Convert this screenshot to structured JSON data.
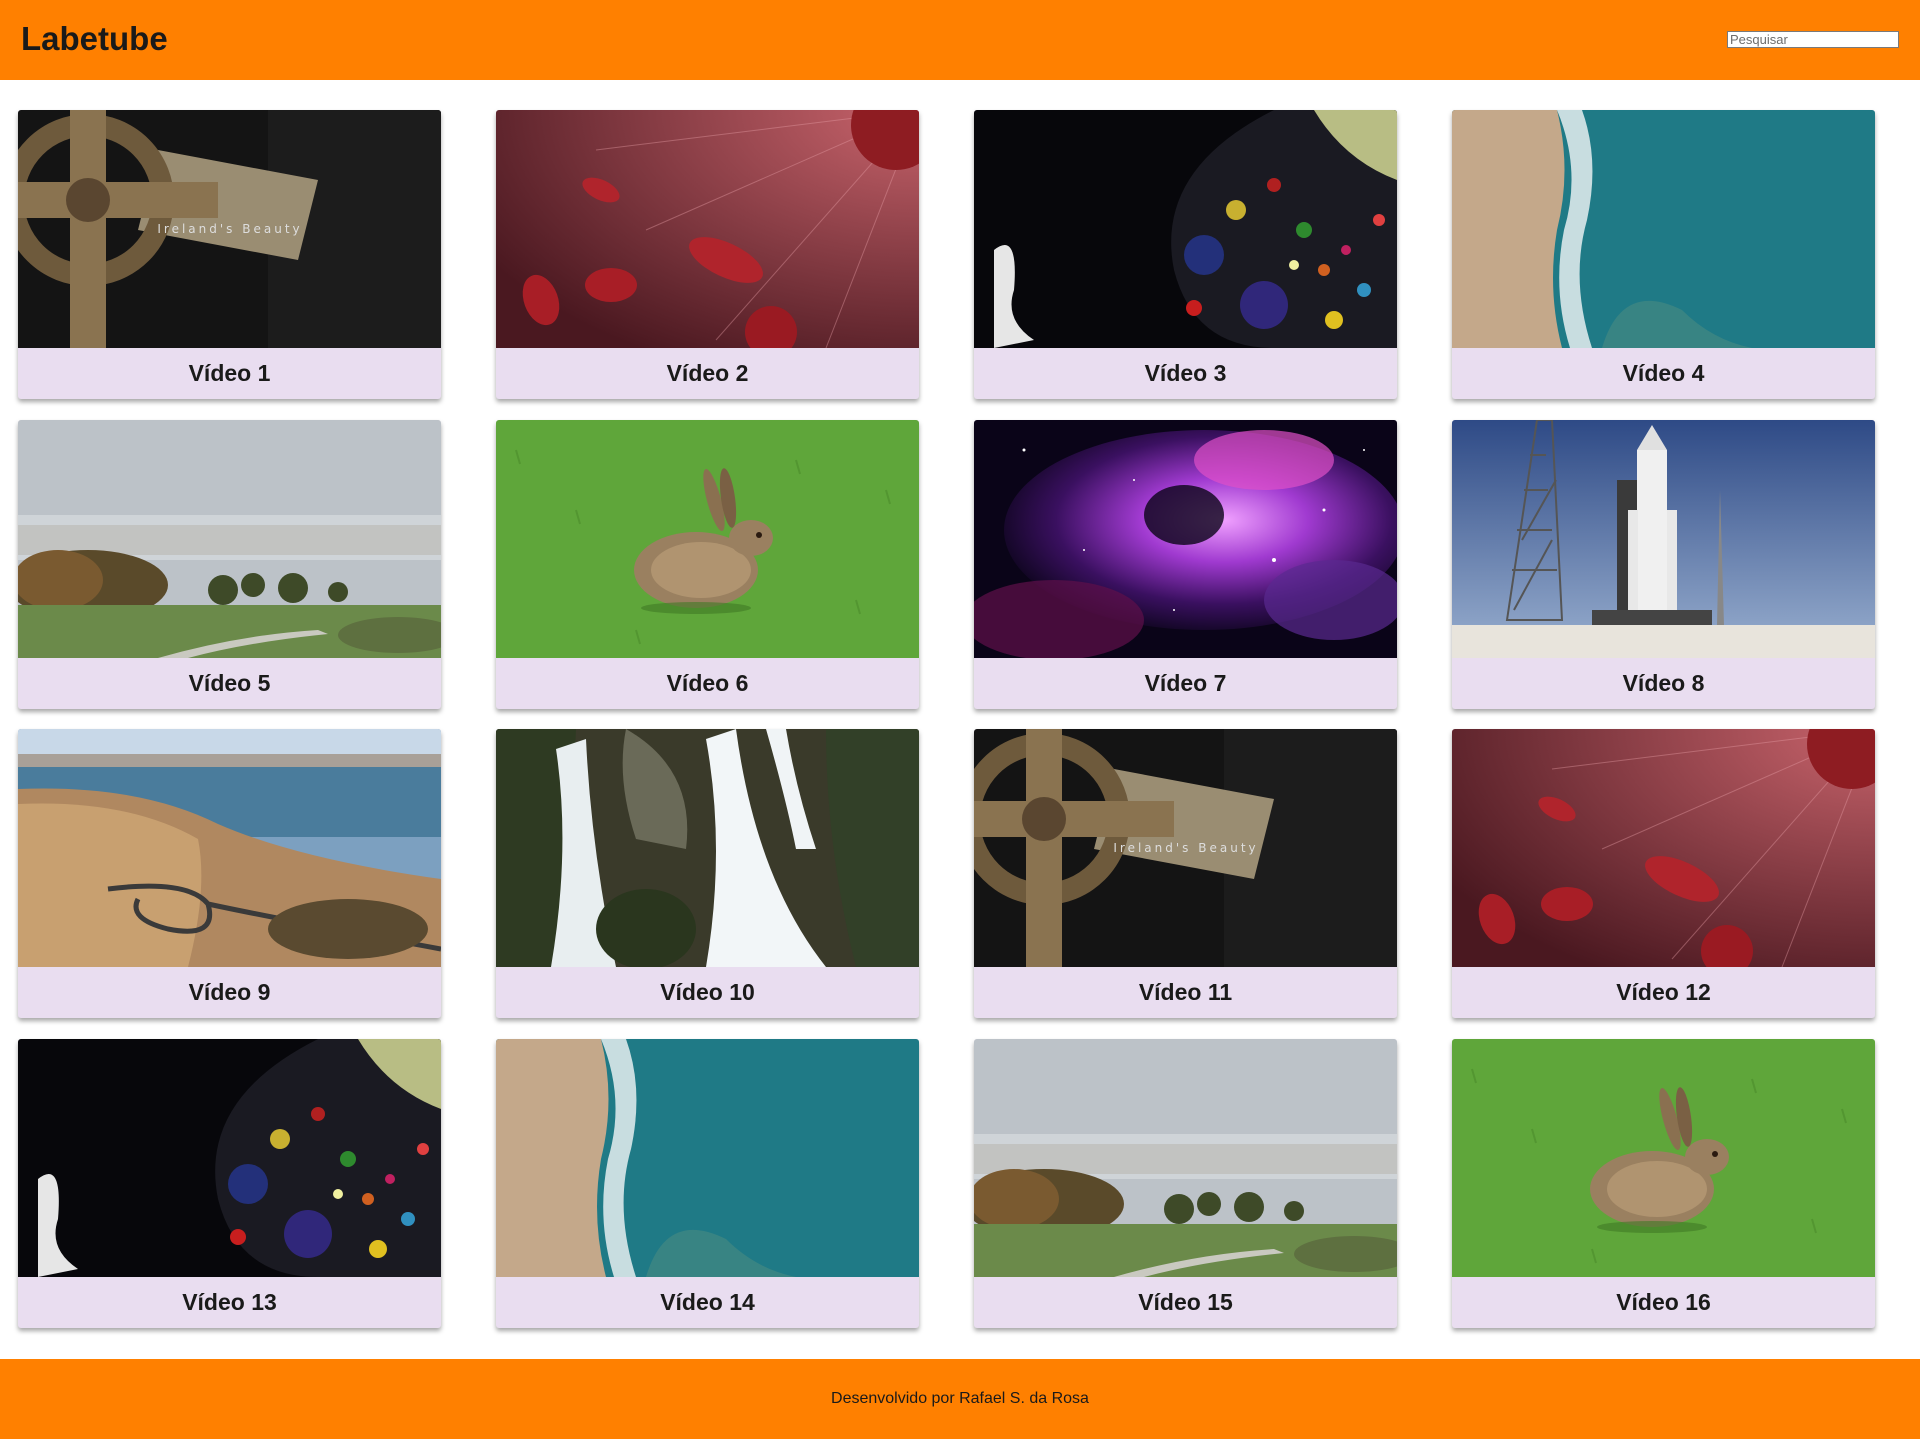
{
  "header": {
    "brand": "Labetube",
    "search_placeholder": "Pesquisar"
  },
  "videos": [
    {
      "title": "Vídeo 1",
      "thumbnail": "celtic-cross",
      "caption": "Ireland's Beauty"
    },
    {
      "title": "Vídeo 2",
      "thumbnail": "blood-cells"
    },
    {
      "title": "Vídeo 3",
      "thumbnail": "ink-bubbles"
    },
    {
      "title": "Vídeo 4",
      "thumbnail": "beach-aerial"
    },
    {
      "title": "Vídeo 5",
      "thumbnail": "foggy-field"
    },
    {
      "title": "Vídeo 6",
      "thumbnail": "hare"
    },
    {
      "title": "Vídeo 7",
      "thumbnail": "nebula"
    },
    {
      "title": "Vídeo 8",
      "thumbnail": "rocket-launchpad"
    },
    {
      "title": "Vídeo 9",
      "thumbnail": "canyon-road"
    },
    {
      "title": "Vídeo 10",
      "thumbnail": "waterfall"
    },
    {
      "title": "Vídeo 11",
      "thumbnail": "celtic-cross",
      "caption": "Ireland's Beauty"
    },
    {
      "title": "Vídeo 12",
      "thumbnail": "blood-cells"
    },
    {
      "title": "Vídeo 13",
      "thumbnail": "ink-bubbles"
    },
    {
      "title": "Vídeo 14",
      "thumbnail": "beach-aerial"
    },
    {
      "title": "Vídeo 15",
      "thumbnail": "foggy-field"
    },
    {
      "title": "Vídeo 16",
      "thumbnail": "hare"
    }
  ],
  "footer": {
    "credit": "Desenvolvido por Rafael S. da Rosa"
  },
  "colors": {
    "header_bg": "#ff8000",
    "footer_bg": "#ff8000",
    "card_bg": "#e9ddf0"
  }
}
